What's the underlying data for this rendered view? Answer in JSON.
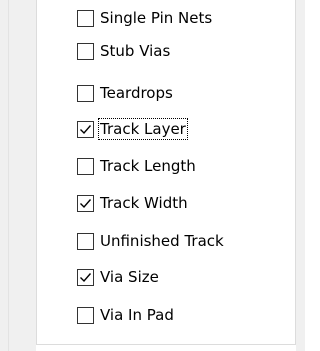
{
  "checklist": {
    "items": [
      {
        "label": "Single Pin Nets",
        "checked": false
      },
      {
        "label": "Stub Vias",
        "checked": false
      },
      {
        "label": "Teardrops",
        "checked": false
      },
      {
        "label": "Track Layer",
        "checked": true,
        "focused": true
      },
      {
        "label": "Track Length",
        "checked": false
      },
      {
        "label": "Track Width",
        "checked": true
      },
      {
        "label": "Unfinished Track",
        "checked": false
      },
      {
        "label": "Via Size",
        "checked": true
      },
      {
        "label": "Via In Pad",
        "checked": false
      }
    ]
  },
  "icons": {
    "checkmark": "checkmark-icon"
  },
  "colors": {
    "window_bg": "#f0f0f0",
    "panel_bg": "#ffffff",
    "checkbox_border": "#333333",
    "text": "#000000"
  }
}
